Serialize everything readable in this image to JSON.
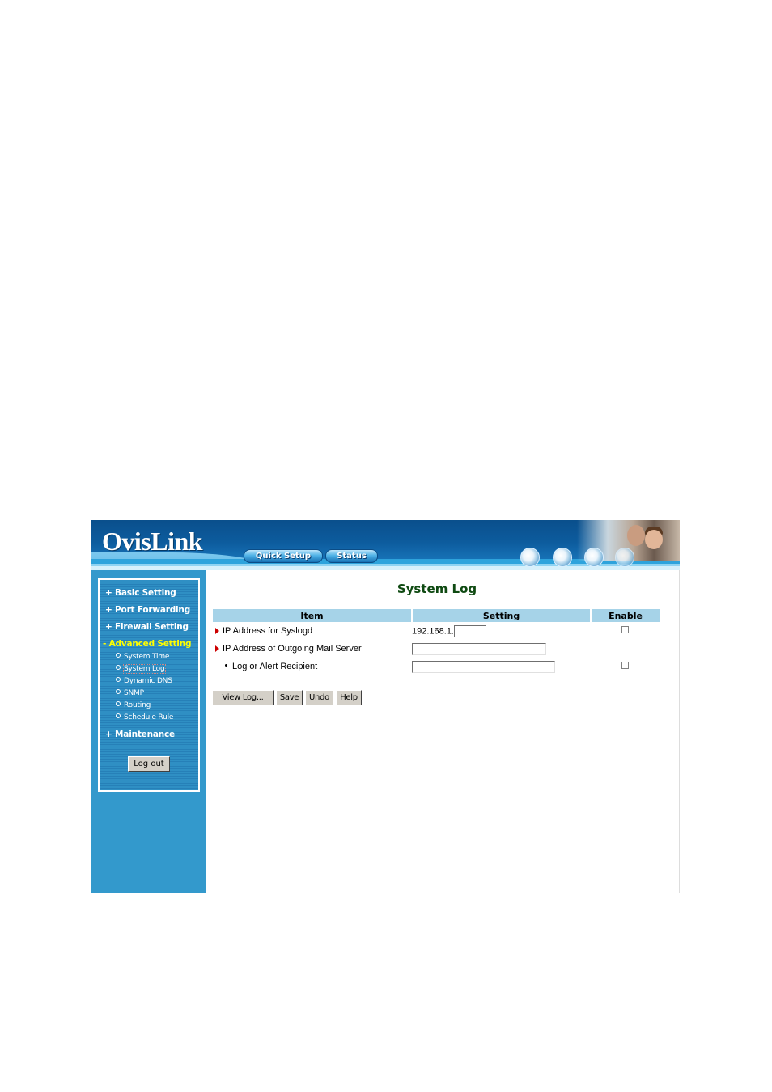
{
  "header": {
    "logo": "OvisLink",
    "nav": [
      {
        "label": "Quick Setup"
      },
      {
        "label": "Status"
      }
    ]
  },
  "sidebar": {
    "menu": [
      {
        "label": "+ Basic Setting",
        "active": false
      },
      {
        "label": "+ Port Forwarding",
        "active": false
      },
      {
        "label": "+ Firewall Setting",
        "active": false
      },
      {
        "label": "- Advanced Setting",
        "active": true
      },
      {
        "label": "+ Maintenance",
        "active": false
      }
    ],
    "submenu": [
      {
        "label": "System Time"
      },
      {
        "label": "System Log",
        "current": true
      },
      {
        "label": "Dynamic DNS"
      },
      {
        "label": "SNMP"
      },
      {
        "label": "Routing"
      },
      {
        "label": "Schedule Rule"
      }
    ],
    "logout_label": "Log out"
  },
  "main": {
    "title": "System Log",
    "table": {
      "headers": [
        "Item",
        "Setting",
        "Enable"
      ],
      "rows": [
        {
          "label": "IP Address for Syslogd",
          "prefix": "192.168.1.",
          "value": "",
          "enabled": false
        },
        {
          "label": "IP Address of Outgoing Mail Server",
          "value": ""
        },
        {
          "label": "Log or Alert Recipient",
          "value": "",
          "enabled": false
        }
      ]
    },
    "buttons": {
      "view_log": "View Log...",
      "save": "Save",
      "undo": "Undo",
      "help": "Help"
    }
  },
  "colors": {
    "sidebar_bg": "#3399cc",
    "active_menu": "#ffff00",
    "table_header_bg": "#a6d3e8",
    "title_color": "#0f4a12",
    "arrow_color": "#cc0000"
  }
}
